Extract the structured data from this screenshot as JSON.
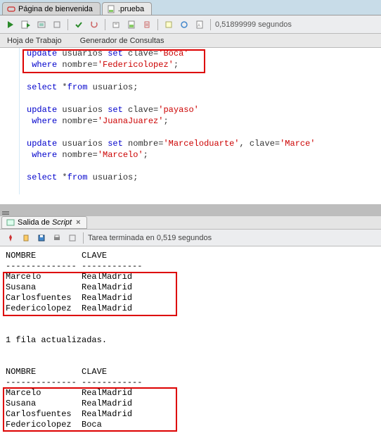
{
  "tabs": {
    "welcome": "Página de bienvenida",
    "file": ".prueba"
  },
  "toolbar": {
    "time": "0,51899999 segundos"
  },
  "subtabs": {
    "worksheet": "Hoja de Trabajo",
    "query_builder": "Generador de Consultas"
  },
  "code": {
    "l1_kw": "update",
    "l1_id": " usuarios ",
    "l1_kw2": "set",
    "l1_id2": " clave=",
    "l1_str": "'Boca'",
    "l2_kw": " where",
    "l2_id": " nombre=",
    "l2_str": "'Federicolopez'",
    "l2_semi": ";",
    "l3_blank": "",
    "l4_kw": "select",
    "l4_id": " *",
    "l4_kw2": "from",
    "l4_id2": " usuarios;",
    "l5_blank": "",
    "l6_kw": "update",
    "l6_id": " usuarios ",
    "l6_kw2": "set",
    "l6_id2": " clave=",
    "l6_str": "'payaso'",
    "l7_kw": " where",
    "l7_id": " nombre=",
    "l7_str": "'JuanaJuarez'",
    "l7_semi": ";",
    "l8_blank": "",
    "l9_kw": "update",
    "l9_id": " usuarios ",
    "l9_kw2": "set",
    "l9_id2": " nombre=",
    "l9_str": "'Marceloduarte'",
    "l9_comma": ", clave=",
    "l9_str2": "'Marce'",
    "l10_kw": " where",
    "l10_id": " nombre=",
    "l10_str": "'Marcelo'",
    "l10_semi": ";",
    "l11_blank": "",
    "l12_kw": "select",
    "l12_id": " *",
    "l12_kw2": "from",
    "l12_id2": " usuarios;"
  },
  "output_tab": {
    "label": "Salida de",
    "label_italic": "Script",
    "close": "×"
  },
  "output_toolbar": {
    "status": "Tarea terminada en 0,519 segundos"
  },
  "results": {
    "header_nombre": "NOMBRE",
    "header_clave": "CLAVE",
    "dashes1": "--------------",
    "dashes2": "------------",
    "t1": [
      {
        "nombre": "Marcelo",
        "clave": "RealMadrid"
      },
      {
        "nombre": "Susana",
        "clave": "RealMadrid"
      },
      {
        "nombre": "Carlosfuentes",
        "clave": "RealMadrid"
      },
      {
        "nombre": "Federicolopez",
        "clave": "RealMadrid"
      }
    ],
    "updated_msg": "1 fila actualizadas.",
    "t2": [
      {
        "nombre": "Marcelo",
        "clave": "RealMadrid"
      },
      {
        "nombre": "Susana",
        "clave": "RealMadrid"
      },
      {
        "nombre": "Carlosfuentes",
        "clave": "RealMadrid"
      },
      {
        "nombre": "Federicolopez",
        "clave": "Boca"
      }
    ]
  }
}
